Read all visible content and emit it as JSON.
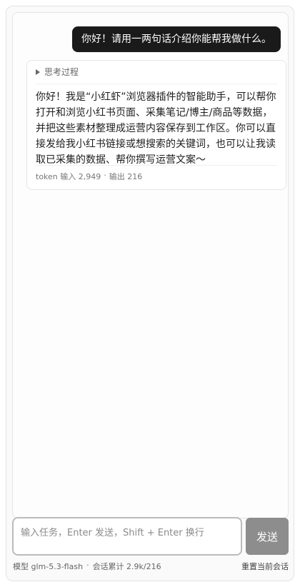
{
  "chat": {
    "user_message": "你好！请用一两句话介绍你能帮我做什么。",
    "assistant": {
      "thinking_label": "思考过程",
      "reply": "你好！我是“小红虾”浏览器插件的智能助手，可以帮你打开和浏览小红书页面、采集笔记/博主/商品等数据，并把这些素材整理成运营内容保存到工作区。你可以直接发给我小红书链接或想搜索的关键词，也可以让我读取已采集的数据、帮你撰写运营文案～",
      "token_label": "token 输入 2,949",
      "separator": "·",
      "output_label": "输出 216"
    }
  },
  "composer": {
    "placeholder": "输入任务，Enter 发送，Shift + Enter 换行",
    "value": "",
    "send_label": "发送"
  },
  "footer": {
    "model_label": "模型 glm-5.3-flash",
    "separator": "·",
    "session_label": "会话累计 2.9k/216",
    "reset_label": "重置当前会话"
  }
}
